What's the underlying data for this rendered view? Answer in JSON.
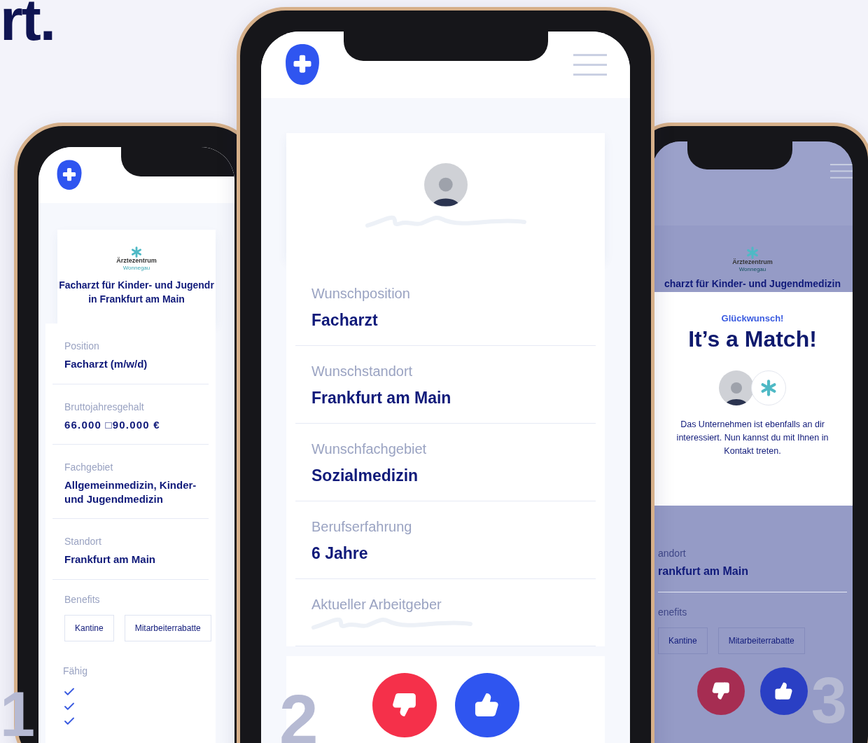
{
  "brand": {
    "text": "rt."
  },
  "phones": [
    {
      "kind": "job",
      "number": "1",
      "company": {
        "name": "Ärztezentrum",
        "location": "Wonnegau"
      },
      "title_lines": [
        "Facharzt für Kinder- und Jugendr",
        "in Frankfurt am Main"
      ],
      "fields": [
        {
          "label": "Position",
          "value": "Facharzt (m/w/d)"
        },
        {
          "label": "Bruttojahresgehalt",
          "value": "66.000 □90.000 €"
        },
        {
          "label": "Fachgebiet",
          "value": "Allgemeinmedizin, Kinder- und Jugendmedizin"
        },
        {
          "label": "Standort",
          "value": "Frankfurt am Main"
        }
      ],
      "benefits_label": "Benefits",
      "benefits": [
        "Kantine",
        "Mitarbeiterrabatte"
      ],
      "skills_label": "Fähig",
      "skills": [
        {
          "checked": true
        },
        {
          "checked": true
        },
        {
          "checked": true
        }
      ]
    },
    {
      "kind": "profile",
      "number": "2",
      "fields": [
        {
          "label": "Wunschposition",
          "value": "Facharzt"
        },
        {
          "label": "Wunschstandort",
          "value": "Frankfurt am Main"
        },
        {
          "label": "Wunschfachgebiet",
          "value": "Sozialmedizin"
        },
        {
          "label": "Berufserfahrung",
          "value": "6 Jahre"
        }
      ],
      "hidden_field": {
        "label": "Aktueller Arbeitgeber"
      }
    },
    {
      "kind": "match",
      "number": "3",
      "company": {
        "name": "Ärztezentrum",
        "location": "Wonnegau"
      },
      "title_lines": [
        "charzt für Kinder- und Jugendmedizin"
      ],
      "match": {
        "kicker": "Glückwunsch!",
        "headline": "It’s a Match!",
        "message": "Das Unternehmen ist ebenfalls an dir interessiert. Nun kannst du mit Ihnen in Kontakt treten."
      },
      "fields": [
        {
          "label": "andort",
          "value": "rankfurt am Main"
        }
      ],
      "benefits_label": "enefits",
      "benefits": [
        "Kantine",
        "Mitarbeiterrabatte"
      ]
    }
  ]
}
